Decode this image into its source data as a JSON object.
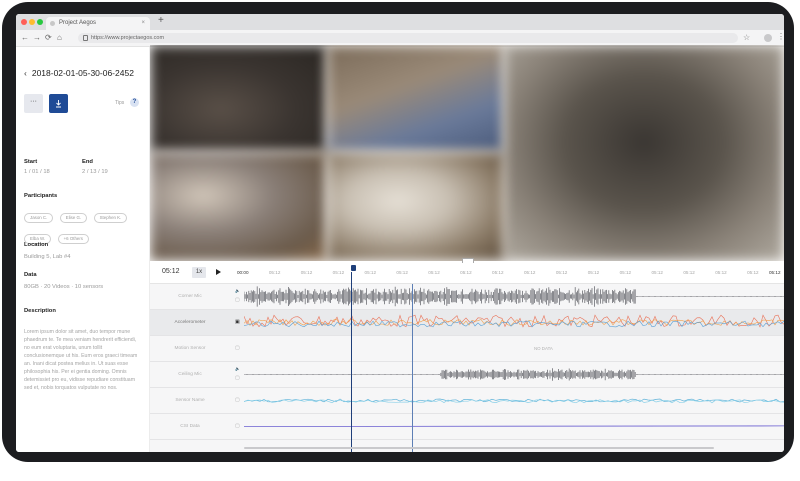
{
  "browser": {
    "tab_title": "Project Aegos",
    "tab_close": "×",
    "new_tab": "+",
    "url": "https://www.projectaegos.com",
    "nav": {
      "back": "←",
      "forward": "→",
      "reload": "⟳",
      "home": "⌂"
    },
    "star": "☆",
    "menu": "⋮",
    "traffic_colors": [
      "#ff5f57",
      "#febc2e",
      "#28c840"
    ]
  },
  "sidebar": {
    "back_glyph": "‹",
    "title": "2018-02-01-05-30-06-2452",
    "more_label": "···",
    "tips_label": "Tips",
    "help_label": "?",
    "start_label": "Start",
    "start_value": "1 / 01 / 18",
    "end_label": "End",
    "end_value": "2 / 13 / 19",
    "participants_label": "Participants",
    "participants": [
      "Jason C.",
      "Elise G.",
      "Stephen K.",
      "Elba W.",
      "+6 Others"
    ],
    "location_label": "Location",
    "location_value": "Building 5, Lab #4",
    "data_label": "Data",
    "data_value": "80GB  ·  20 Videos  ·  10 sensors",
    "description_label": "Description",
    "description": "Lorem ipsum dolor sit amet, duo tempor mune phaedrum te. Te mea veniam hendrerit efficiendi, no eum erat voluptaria, unum tollit conclusionemque ut his. Eum eros graeci timeam an. Inani dicat postea melius in. Ut suas esse philosophia his. Per ei gentia doming. Omnis detemissiet pro eu, vidisse repudiare constituam sed et, nobis torquatos vulputate no nos."
  },
  "timeline": {
    "current_time": "05:12",
    "speed": "1x",
    "ticks": [
      "00:00",
      "05:12",
      "05:12",
      "05:12",
      "05:12",
      "05:12",
      "05:12",
      "05:12",
      "05:12",
      "05:12",
      "05:12",
      "05:12",
      "05:12",
      "05:12",
      "05:12",
      "05:12",
      "05:12",
      "05:12"
    ],
    "tracks": [
      {
        "name": "Corner Mic",
        "selected": false,
        "type": "audio",
        "color": "#6d6e73"
      },
      {
        "name": "Accelerometer",
        "selected": true,
        "type": "sensor",
        "color": "#e97157"
      },
      {
        "name": "Motion Sensor",
        "selected": false,
        "type": "empty",
        "status": "NO DATA"
      },
      {
        "name": "Ceiling Mic",
        "selected": false,
        "type": "audio-short",
        "color": "#6d6e73"
      },
      {
        "name": "Sensor Name",
        "selected": false,
        "type": "line",
        "color": "#5fb3d9"
      },
      {
        "name": "CSI Data",
        "selected": false,
        "type": "flat",
        "color": "#6a5fd0"
      }
    ]
  }
}
